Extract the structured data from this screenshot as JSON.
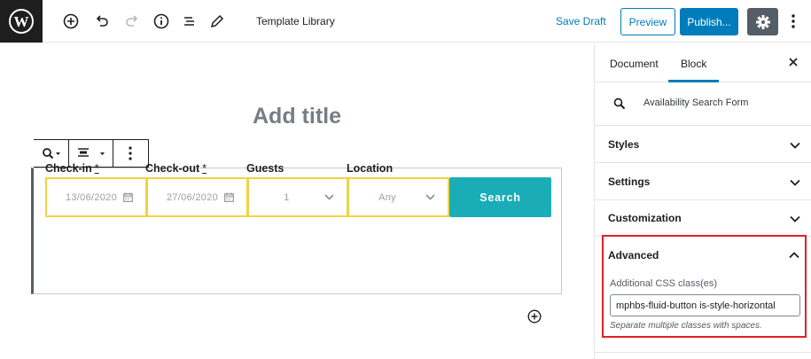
{
  "toolbar": {
    "doc_title": "Template Library",
    "save_draft": "Save Draft",
    "preview": "Preview",
    "publish": "Publish..."
  },
  "editor": {
    "title_placeholder": "Add title"
  },
  "form": {
    "fields": [
      {
        "label": "Check-in",
        "required": "*",
        "value": "13/06/2020"
      },
      {
        "label": "Check-out",
        "required": "*",
        "value": "27/06/2020"
      },
      {
        "label": "Guests",
        "required": "",
        "value": "1"
      },
      {
        "label": "Location",
        "required": "",
        "value": "Any"
      }
    ],
    "submit": "Search"
  },
  "sidebar": {
    "tabs": [
      {
        "label": "Document"
      },
      {
        "label": "Block"
      }
    ],
    "active_tab": "Block",
    "block_name": "Availability Search Form",
    "panels": [
      {
        "title": "Styles"
      },
      {
        "title": "Settings"
      },
      {
        "title": "Customization"
      }
    ],
    "advanced": {
      "title": "Advanced",
      "css_label": "Additional CSS class(es)",
      "css_value": "mphbs-fluid-button is-style-horizontal",
      "help": "Separate multiple classes with spaces."
    }
  },
  "colors": {
    "accent": "#007cba",
    "search_button": "#1aadb7",
    "field_border": "#f0d343",
    "highlight": "#e0202a"
  }
}
